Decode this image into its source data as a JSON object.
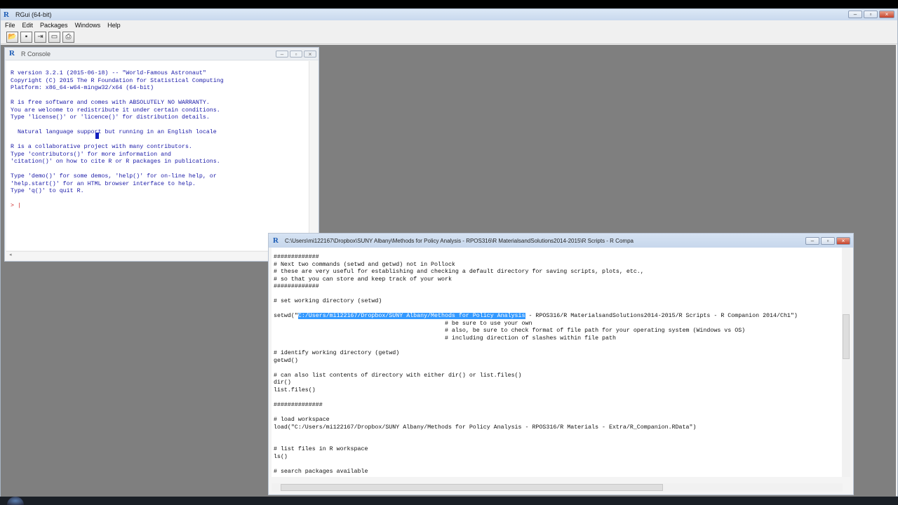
{
  "app": {
    "title": "RGui (64-bit)",
    "menus": [
      "File",
      "Edit",
      "Packages",
      "Windows",
      "Help"
    ],
    "toolbar_icons": [
      "open-script-icon",
      "save-icon",
      "load-workspace-icon",
      "console-icon",
      "print-icon"
    ]
  },
  "console": {
    "title": "R Console",
    "lines": [
      "R version 3.2.1 (2015-06-18) -- \"World-Famous Astronaut\"",
      "Copyright (C) 2015 The R Foundation for Statistical Computing",
      "Platform: x86_64-w64-mingw32/x64 (64-bit)",
      "",
      "R is free software and comes with ABSOLUTELY NO WARRANTY.",
      "You are welcome to redistribute it under certain conditions.",
      "Type 'license()' or 'licence()' for distribution details.",
      "",
      "  Natural language support but running in an English locale",
      "",
      "R is a collaborative project with many contributors.",
      "Type 'contributors()' for more information and",
      "'citation()' on how to cite R or R packages in publications.",
      "",
      "Type 'demo()' for some demos, 'help()' for on-line help, or",
      "'help.start()' for an HTML browser interface to help.",
      "Type 'q()' to quit R.",
      ""
    ],
    "prompt": "> |"
  },
  "editor": {
    "title": "C:\\Users\\mi122167\\Dropbox\\SUNY Albany\\Methods for Policy Analysis - RPOS316\\R MaterialsandSolutions2014-2015\\R Scripts - R Compa",
    "lines_before_sel": "#############\n# Next two commands (setwd and getwd) not in Pollock\n# these are very useful for establishing and checking a default directory for saving scripts, plots, etc.,\n# so that you can store and keep track of your work\n#############\n\n# set working directory (setwd)\n\nsetwd(\"",
    "selected": "C:/Users/mi122167/Dropbox/SUNY Albany/Methods for Policy Analysis",
    "lines_after_sel": " - RPOS316/R MaterialsandSolutions2014-2015/R Scripts - R Companion 2014/Ch1\")\n                                                 # be sure to use your own\n                                                 # also, be sure to check format of file path for your operating system (Windows vs OS)\n                                                 # including direction of slashes within file path\n\n# identify working directory (getwd)\ngetwd()\n\n# can also list contents of directory with either dir() or list.files()\ndir()\nlist.files()\n\n##############\n\n# load workspace\nload(\"C:/Users/mi122167/Dropbox/SUNY Albany/Methods for Policy Analysis - RPOS316/R Materials - Extra/R_Companion.RData\")\n\n\n# list files in R workspace\nls()\n\n# search packages available"
  }
}
